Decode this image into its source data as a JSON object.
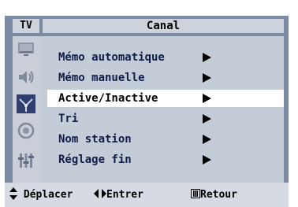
{
  "header": {
    "tv_label": "TV",
    "title": "Canal"
  },
  "sidebar": {
    "icons": [
      "picture-icon",
      "sound-icon",
      "channel-icon",
      "setup-icon",
      "input-icon"
    ]
  },
  "menu": {
    "items": [
      {
        "label": "Mémo automatique"
      },
      {
        "label": "Mémo manuelle"
      },
      {
        "label": "Active/Inactive",
        "selected": true
      },
      {
        "label": "Tri"
      },
      {
        "label": "Nom station"
      },
      {
        "label": "Réglage fin"
      }
    ]
  },
  "footer": {
    "move_label": "Déplacer",
    "enter_label": "Entrer",
    "return_label": "Retour"
  },
  "colors": {
    "frame": "#7b8ba3",
    "panel": "#c4ccd8",
    "highlight": "#ffffff",
    "text": "#121c48"
  }
}
